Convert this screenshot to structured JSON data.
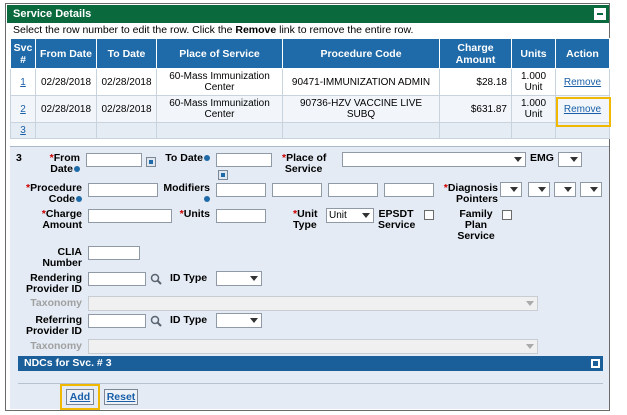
{
  "panel": {
    "title": "Service Details"
  },
  "instructions": {
    "before": "Select the row number to edit the row. Click the ",
    "bold": "Remove",
    "after": " link to remove the entire row."
  },
  "table": {
    "headers": [
      "Svc #",
      "From Date",
      "To Date",
      "Place of Service",
      "Procedure Code",
      "Charge Amount",
      "Units",
      "Action"
    ],
    "rows": [
      {
        "svc": "1",
        "from": "02/28/2018",
        "to": "02/28/2018",
        "place": "60-Mass Immunization Center",
        "proc": "90471-IMMUNIZATION ADMIN",
        "charge": "$28.18",
        "units": "1.000 Unit",
        "action": "Remove"
      },
      {
        "svc": "2",
        "from": "02/28/2018",
        "to": "02/28/2018",
        "place": "60-Mass Immunization Center",
        "proc": "90736-HZV VACCINE LIVE SUBQ",
        "charge": "$631.87",
        "units": "1.000 Unit",
        "action": "Remove"
      },
      {
        "svc": "3"
      }
    ]
  },
  "form": {
    "row_number": "3",
    "from_date_l1": "From",
    "from_date_l2": "Date",
    "to_date": "To Date",
    "place_l1": "Place of",
    "place_l2": "Service",
    "emg": "EMG",
    "proc_l1": "Procedure",
    "proc_l2": "Code",
    "modifiers": "Modifiers",
    "diag_l1": "Diagnosis",
    "diag_l2": "Pointers",
    "charge_l1": "Charge",
    "charge_l2": "Amount",
    "units": "Units",
    "unit_type_l1": "Unit",
    "unit_type_l2": "Type",
    "unit_type_value": "Unit",
    "epsdt_l1": "EPSDT",
    "epsdt_l2": "Service",
    "family_l1": "Family",
    "family_l2": "Plan",
    "family_l3": "Service",
    "clia_l1": "CLIA",
    "clia_l2": "Number",
    "rendering_l1": "Rendering",
    "rendering_l2": "Provider ID",
    "id_type": "ID Type",
    "taxonomy": "Taxonomy",
    "referring_l1": "Referring",
    "referring_l2": "Provider ID",
    "id_type2": "ID Type",
    "taxonomy2": "Taxonomy"
  },
  "ndc": {
    "title": "NDCs for Svc. # 3"
  },
  "buttons": {
    "add": "Add",
    "reset": "Reset"
  },
  "colors": {
    "title_bar": "#0a6a3d",
    "header": "#1f6aa8",
    "highlight": "#f0b800",
    "form_bg": "#e4ebf4"
  }
}
